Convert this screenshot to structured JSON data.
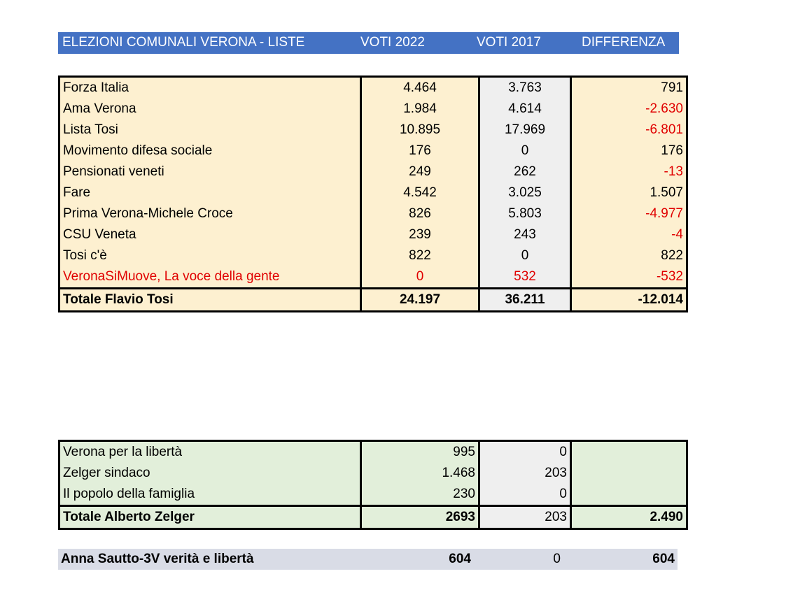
{
  "header": {
    "title": "ELEZIONI COMUNALI VERONA - LISTE",
    "col_2022": "VOTI 2022",
    "col_2017": "VOTI 2017",
    "col_diff": "DIFFERENZA"
  },
  "tosi": {
    "rows": [
      {
        "name": "Forza Italia",
        "v2022": "4.464",
        "v2017": "3.763",
        "diff": "791"
      },
      {
        "name": "Ama Verona",
        "v2022": "1.984",
        "v2017": "4.614",
        "diff": "-2.630"
      },
      {
        "name": "Lista Tosi",
        "v2022": "10.895",
        "v2017": "17.969",
        "diff": "-6.801"
      },
      {
        "name": "Movimento difesa sociale",
        "v2022": "176",
        "v2017": "0",
        "diff": "176"
      },
      {
        "name": "Pensionati veneti",
        "v2022": "249",
        "v2017": "262",
        "diff": "-13"
      },
      {
        "name": "Fare",
        "v2022": "4.542",
        "v2017": "3.025",
        "diff": "1.507"
      },
      {
        "name": "Prima Verona-Michele Croce",
        "v2022": "826",
        "v2017": "5.803",
        "diff": "-4.977"
      },
      {
        "name": "CSU Veneta",
        "v2022": "239",
        "v2017": "243",
        "diff": "-4"
      },
      {
        "name": "Tosi c'è",
        "v2022": "822",
        "v2017": "0",
        "diff": "822"
      },
      {
        "name": "VeronaSiMuove, La voce della gente",
        "v2022": "0",
        "v2017": "532",
        "diff": "-532"
      }
    ],
    "total": {
      "name": "Totale Flavio Tosi",
      "v2022": "24.197",
      "v2017": "36.211",
      "diff": "-12.014"
    }
  },
  "zelger": {
    "rows": [
      {
        "name": "Verona per la libertà",
        "v2022": "995",
        "v2017": "0",
        "diff": ""
      },
      {
        "name": "Zelger sindaco",
        "v2022": "1.468",
        "v2017": "203",
        "diff": ""
      },
      {
        "name": "Il popolo della famiglia",
        "v2022": "230",
        "v2017": "0",
        "diff": ""
      }
    ],
    "total": {
      "name": "Totale Alberto Zelger",
      "v2022": "2693",
      "v2017": "203",
      "diff": "2.490"
    }
  },
  "sautto": {
    "name": "Anna Sautto-3V verità e libertà",
    "v2022": "604",
    "v2017": "0",
    "diff": "604"
  },
  "colors": {
    "header_bg": "#4472c4",
    "negative": "#e00000",
    "tosi_bg": "#fdf0d0",
    "zelger_bg": "#e2efda",
    "sautto_bg": "#d9dce6"
  }
}
